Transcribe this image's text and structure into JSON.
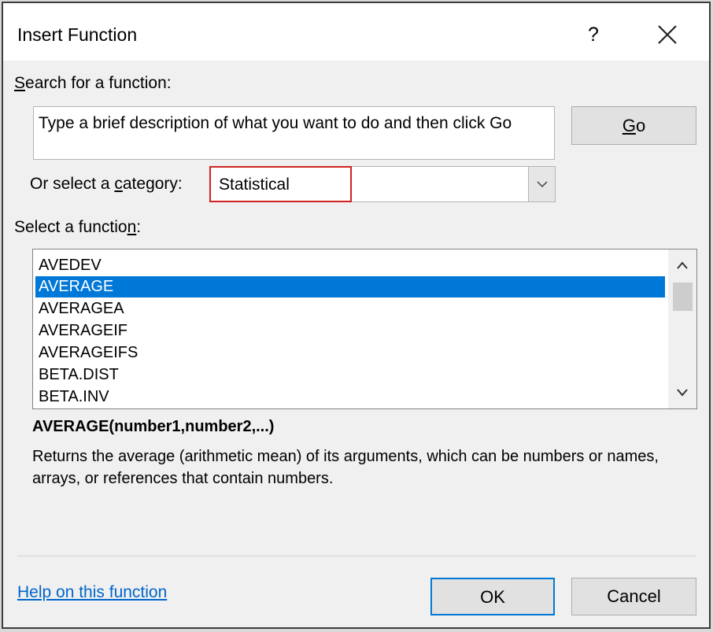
{
  "dialog": {
    "title": "Insert Function",
    "help_glyph": "?",
    "close_glyph": "✕"
  },
  "search": {
    "label_prefix": "",
    "label_key": "S",
    "label_rest": "earch for a function:",
    "value": "Type a brief description of what you want to do and then click Go",
    "go_key": "G",
    "go_rest": "o"
  },
  "category": {
    "label_prefix": "Or select a ",
    "label_key": "c",
    "label_rest": "ategory:",
    "selected": "Statistical"
  },
  "functions": {
    "label_prefix": "Select a functio",
    "label_key": "n",
    "label_rest": ":",
    "items": [
      "AVEDEV",
      "AVERAGE",
      "AVERAGEA",
      "AVERAGEIF",
      "AVERAGEIFS",
      "BETA.DIST",
      "BETA.INV"
    ],
    "selected_index": 1
  },
  "details": {
    "signature": "AVERAGE(number1,number2,...)",
    "description": "Returns the average (arithmetic mean) of its arguments, which can be numbers or names, arrays, or references that contain numbers."
  },
  "footer": {
    "help_link": "Help on this function",
    "ok_label": "OK",
    "cancel_label": "Cancel"
  },
  "colors": {
    "selection": "#0078d7",
    "category_highlight": "#d02222",
    "link": "#0066cc"
  }
}
